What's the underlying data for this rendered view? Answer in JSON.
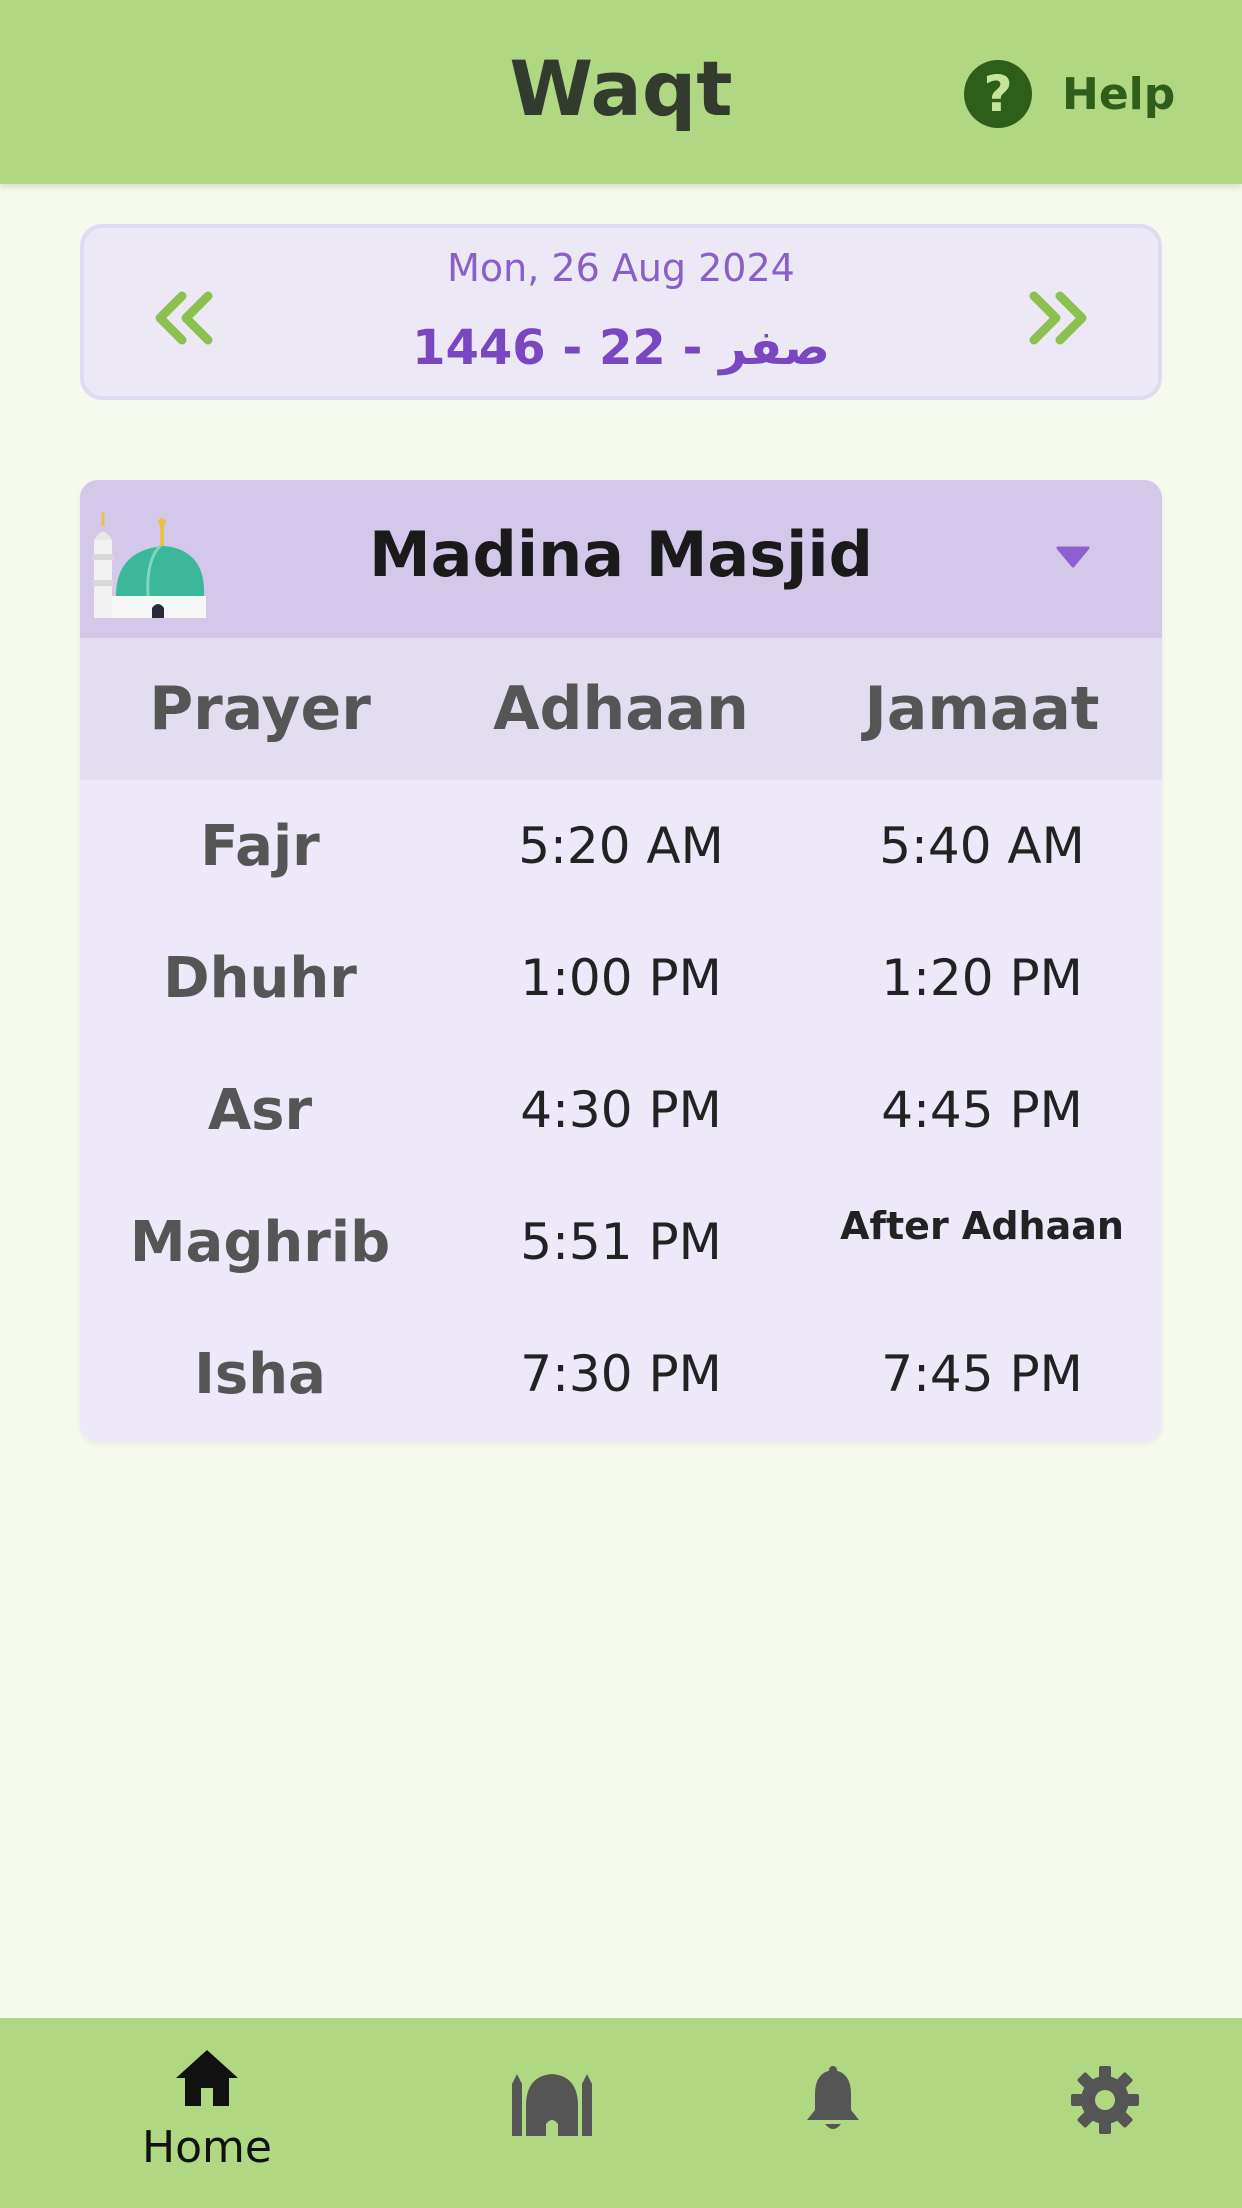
{
  "header": {
    "title": "Waqt",
    "help_label": "Help"
  },
  "date_card": {
    "gregorian": "Mon, 26 Aug 2024",
    "hijri": "1446 - صفر - 22"
  },
  "masjid": {
    "name": "Madina Masjid",
    "columns": [
      "Prayer",
      "Adhaan",
      "Jamaat"
    ],
    "rows": [
      {
        "prayer": "Fajr",
        "adhaan": "5:20 AM",
        "jamaat": "5:40 AM"
      },
      {
        "prayer": "Dhuhr",
        "adhaan": "1:00 PM",
        "jamaat": "1:20 PM"
      },
      {
        "prayer": "Asr",
        "adhaan": "4:30 PM",
        "jamaat": "4:45 PM"
      },
      {
        "prayer": "Maghrib",
        "adhaan": "5:51 PM",
        "jamaat": "After Adhaan"
      },
      {
        "prayer": "Isha",
        "adhaan": "7:30 PM",
        "jamaat": "7:45 PM"
      }
    ]
  },
  "bottom_nav": {
    "items": [
      {
        "icon": "home-icon",
        "label": "Home",
        "active": true
      },
      {
        "icon": "mosque-icon",
        "label": ""
      },
      {
        "icon": "bell-icon",
        "label": ""
      },
      {
        "icon": "gear-icon",
        "label": ""
      }
    ]
  },
  "colors": {
    "header_bg": "#b0d883",
    "accent_purple": "#7a47c2",
    "arrow_green": "#8cc152",
    "card_bg": "#ede9f8"
  }
}
